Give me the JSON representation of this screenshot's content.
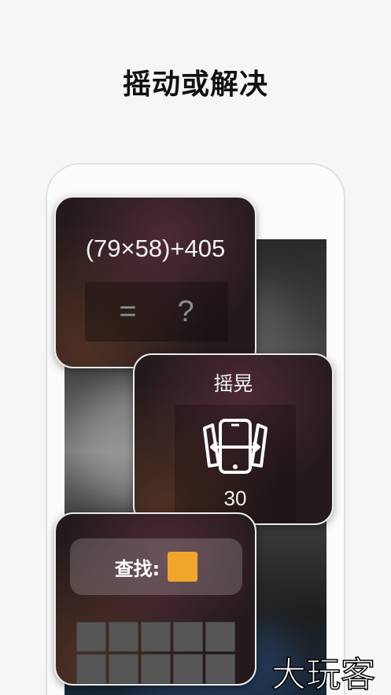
{
  "headline": "摇动或解决",
  "math_card": {
    "equation": "(79×58)+405",
    "equals": "=",
    "unknown": "?"
  },
  "shake_card": {
    "title": "摇晃",
    "icon": "shake-phone-icon",
    "count": "30"
  },
  "find_card": {
    "label": "查找:",
    "target_color": "#f2a52b",
    "grid_cells": 10
  },
  "watermark": "大玩客"
}
